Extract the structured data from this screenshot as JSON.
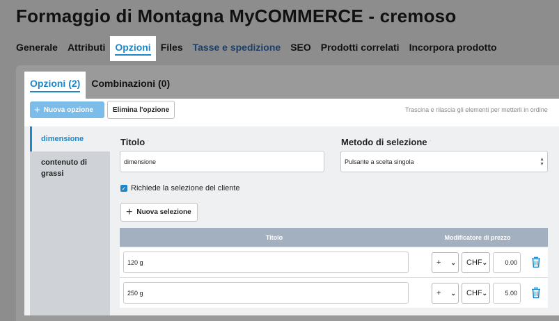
{
  "page": {
    "title": "Formaggio di Montagna MyCOMMERCE - cremoso"
  },
  "main_tabs": [
    {
      "label": "Generale"
    },
    {
      "label": "Attributi"
    },
    {
      "label": "Opzioni"
    },
    {
      "label": "Files"
    },
    {
      "label": "Tasse e spedizione"
    },
    {
      "label": "SEO"
    },
    {
      "label": "Prodotti correlati"
    },
    {
      "label": "Incorpora prodotto"
    }
  ],
  "sub_tabs": [
    {
      "label": "Opzioni (2)"
    },
    {
      "label": "Combinazioni (0)"
    }
  ],
  "toolbar": {
    "new_option": "Nuova opzione",
    "delete_option": "Elimina l'opzione",
    "drag_hint": "Trascina e rilascia gli elementi per metterli in ordine"
  },
  "sidebar": {
    "items": [
      {
        "label": "dimensione"
      },
      {
        "label": "contenuto di grassi"
      }
    ]
  },
  "form": {
    "title_label": "Titolo",
    "title_value": "dimensione",
    "method_label": "Metodo di selezione",
    "method_value": "Pulsante a scelta singola",
    "required_marker": "·",
    "checkbox_label": "Richiede la selezione del cliente",
    "new_selection": "Nuova selezione"
  },
  "table": {
    "headers": {
      "title": "Titolo",
      "modifier": "Modificatore di prezzo"
    },
    "rows": [
      {
        "title": "120 g",
        "sign": "+",
        "currency": "CHF",
        "price": "0.00"
      },
      {
        "title": "250 g",
        "sign": "+",
        "currency": "CHF",
        "price": "5.00"
      }
    ]
  },
  "colors": {
    "accent": "#1f86c8",
    "header_bg": "#a3b0c0",
    "primary_button": "#7bbde8"
  }
}
